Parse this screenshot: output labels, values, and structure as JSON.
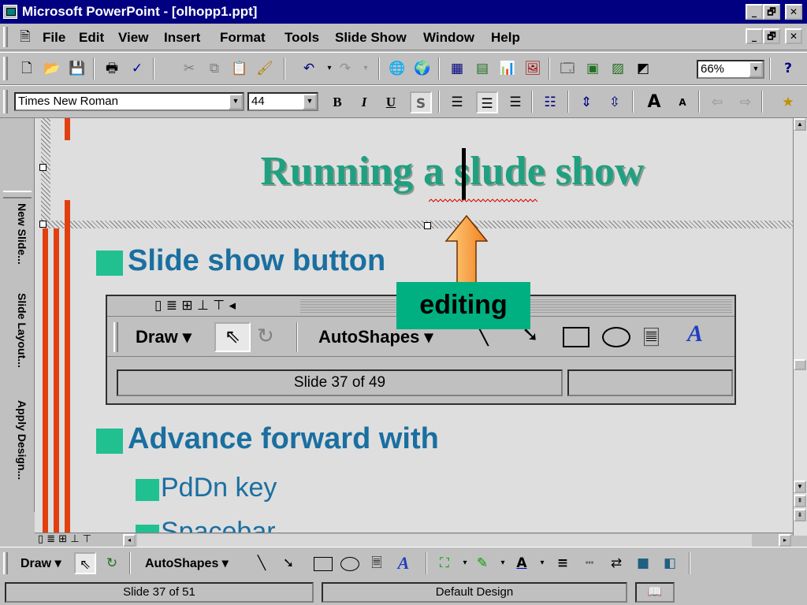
{
  "window": {
    "title": "Microsoft PowerPoint - [olhopp1.ppt]",
    "controls": [
      "_",
      "🗗",
      "✕"
    ]
  },
  "menu": {
    "items": [
      "File",
      "Edit",
      "View",
      "Insert",
      "Format",
      "Tools",
      "Slide Show",
      "Window",
      "Help"
    ],
    "doc_controls": [
      "_",
      "🗗",
      "✕"
    ]
  },
  "standard_toolbar": {
    "zoom": "66%",
    "icons": [
      "new-icon",
      "open-icon",
      "save-icon",
      "print-icon",
      "spelling-icon",
      "cut-icon",
      "copy-icon",
      "paste-icon",
      "format-painter-icon",
      "undo-icon",
      "redo-icon",
      "insert-hyperlink-icon",
      "web-toolbar-icon",
      "insert-word-table-icon",
      "insert-excel-worksheet-icon",
      "insert-chart-icon",
      "insert-clipart-icon",
      "new-slide-icon",
      "slide-layout-icon",
      "apply-design-icon",
      "grayscale-preview-icon",
      "help-icon"
    ]
  },
  "formatting_toolbar": {
    "font": "Times New Roman",
    "size": "44",
    "bold": "B",
    "italic": "I",
    "underline": "U",
    "shadow": "S",
    "icons": [
      "align-left-icon",
      "center-icon",
      "align-right-icon",
      "bullets-icon",
      "increase-paragraph-spacing-icon",
      "decrease-paragraph-spacing-icon",
      "increase-font-size-icon",
      "decrease-font-size-icon",
      "promote-icon",
      "demote-icon",
      "animation-effects-icon"
    ]
  },
  "side_panel": {
    "items": [
      "New Slide...",
      "Slide Layout...",
      "Apply Design..."
    ]
  },
  "slide": {
    "title": "Running a slude show",
    "bullet1": "Slide show button",
    "bullet2": "Advance forward with",
    "sub_bullet1": "PdDn key",
    "sub_bullet2": "Spacebar",
    "callout": "editing"
  },
  "inset": {
    "draw_label": "Draw",
    "autoshapes_label": "AutoShapes",
    "status": "Slide 37 of 49"
  },
  "drawing_toolbar": {
    "draw_label": "Draw",
    "autoshapes_label": "AutoShapes"
  },
  "status_bar": {
    "slide": "Slide 37 of 51",
    "design": "Default Design"
  }
}
